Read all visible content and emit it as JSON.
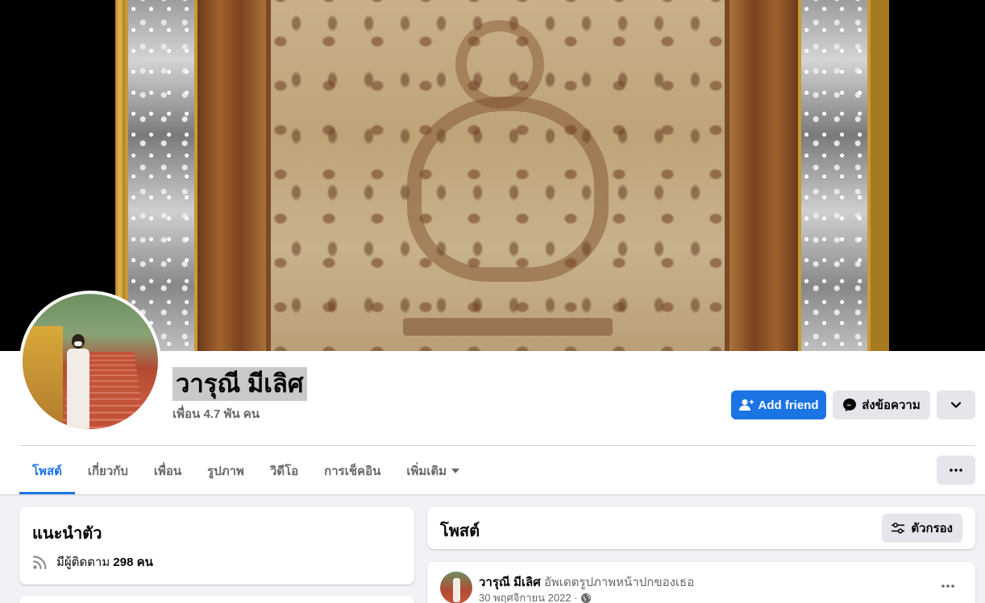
{
  "profile": {
    "name": "วารุณี มีเลิศ",
    "friends": "เพื่อน 4.7 พัน คน"
  },
  "actions": {
    "add_friend": "Add friend",
    "message": "ส่งข้อความ"
  },
  "tabs": [
    {
      "label": "โพสต์"
    },
    {
      "label": "เกี่ยวกับ"
    },
    {
      "label": "เพื่อน"
    },
    {
      "label": "รูปภาพ"
    },
    {
      "label": "วิดีโอ"
    },
    {
      "label": "การเช็คอิน"
    },
    {
      "label": "เพิ่มเติม"
    }
  ],
  "intro": {
    "title": "แนะนำตัว",
    "followers_prefix": "มีผู้ติดตาม",
    "followers_count": "298 คน"
  },
  "posts": {
    "title": "โพสต์",
    "filter_label": "ตัวกรอง"
  },
  "post": {
    "author": "วารุณี มีเลิศ",
    "action": "อัพเดตรูปภาพหน้าปกของเธอ",
    "date": "30 พฤศจิกายน 2022 ·"
  },
  "colors": {
    "accent": "#1b74e4",
    "background": "#f0f2f5",
    "secondary_button": "#e4e6eb"
  }
}
